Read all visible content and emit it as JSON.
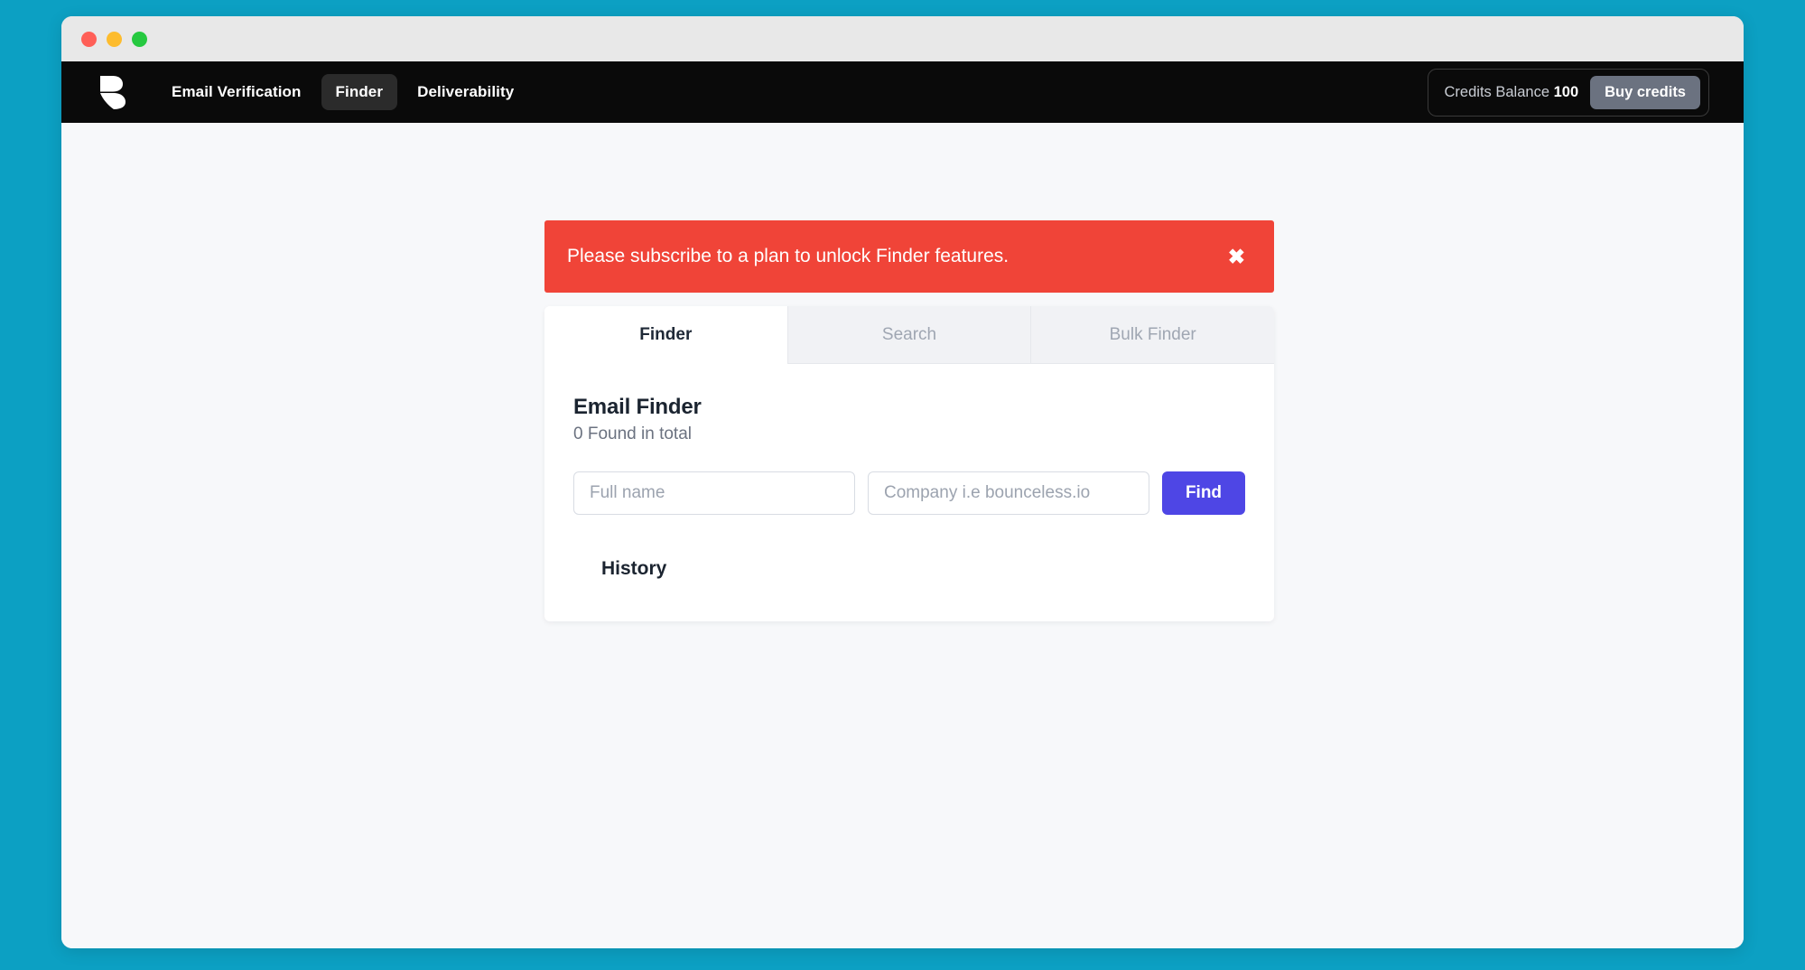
{
  "theme": {
    "desktop_background": "#0CA0C3",
    "navbar_background": "#0A0A0A",
    "page_background": "#F7F8FA",
    "alert_color": "#F04438",
    "primary_button_color": "#4E46E5",
    "buy_credits_color": "#6B7280"
  },
  "window": {
    "traffic_lights": [
      {
        "name": "close",
        "color": "#FF5F57"
      },
      {
        "name": "minimize",
        "color": "#FDBC2E"
      },
      {
        "name": "maximize",
        "color": "#26C940"
      }
    ]
  },
  "navbar": {
    "logo_icon": "bounceless-b-logo-icon",
    "links": [
      {
        "label": "Email Verification",
        "active": false
      },
      {
        "label": "Finder",
        "active": true
      },
      {
        "label": "Deliverability",
        "active": false
      }
    ],
    "credits": {
      "label": "Credits Balance",
      "value": "100",
      "buy_button_label": "Buy credits"
    }
  },
  "alert": {
    "message": "Please subscribe to a plan to unlock Finder features.",
    "close_icon": "close-icon",
    "close_glyph": "✖"
  },
  "card": {
    "tabs": [
      {
        "label": "Finder",
        "active": true
      },
      {
        "label": "Search",
        "active": false
      },
      {
        "label": "Bulk Finder",
        "active": false
      }
    ],
    "finder": {
      "title": "Email Finder",
      "subtitle": "0 Found in total",
      "found_count": 0,
      "name_input": {
        "value": "",
        "placeholder": "Full name"
      },
      "company_input": {
        "value": "",
        "placeholder": "Company i.e bounceless.io"
      },
      "find_button_label": "Find"
    },
    "history": {
      "title": "History",
      "items": []
    }
  }
}
